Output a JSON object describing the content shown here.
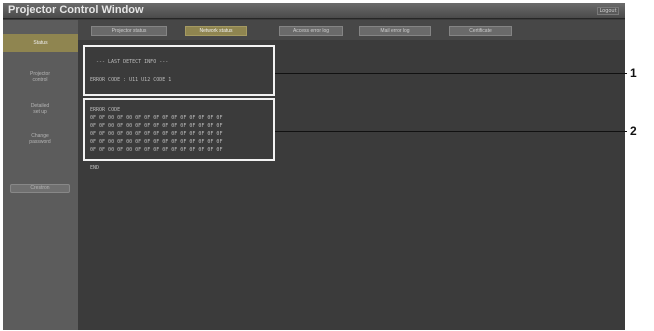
{
  "window": {
    "title": "Projector Control Window",
    "logout_label": "Logout"
  },
  "sidebar": {
    "items": [
      {
        "label": "Status"
      },
      {
        "label": "Projector\ncontrol"
      },
      {
        "label": "Detailed\nset up"
      },
      {
        "label": "Change\npassword"
      },
      {
        "label": "Crestron"
      }
    ]
  },
  "tabs": [
    {
      "label": "Projector status"
    },
    {
      "label": "Network status"
    },
    {
      "label": "Access error log"
    },
    {
      "label": "Mail error log"
    },
    {
      "label": "Certificate"
    }
  ],
  "panel1": {
    "lines": [
      "--- LAST DETECT INFO ---",
      "ERROR CODE : U11 U12 CODE 1"
    ]
  },
  "panel2": {
    "header": "ERROR CODE",
    "rows": [
      "0F 0F 00 0F 00 0F 0F 0F 0F 0F 0F 0F 0F 0F 0F",
      "0F 0F 00 0F 00 0F 0F 0F 0F 0F 0F 0F 0F 0F 0F",
      "0F 0F 00 0F 00 0F 0F 0F 0F 0F 0F 0F 0F 0F 0F",
      "0F 0F 00 0F 00 0F 0F 0F 0F 0F 0F 0F 0F 0F 0F",
      "0F 0F 00 0F 00 0F 0F 0F 0F 0F 0F 0F 0F 0F 0F"
    ],
    "footer": "END"
  },
  "callouts": [
    {
      "number": "1"
    },
    {
      "number": "2"
    }
  ]
}
